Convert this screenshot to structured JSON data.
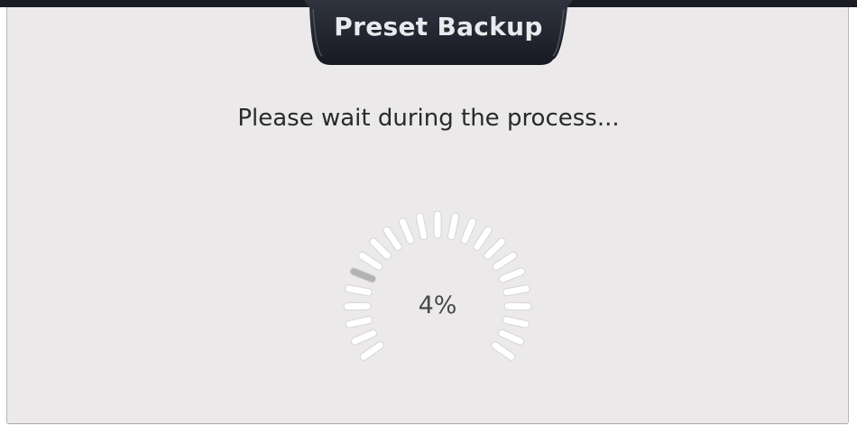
{
  "dialog": {
    "title": "Preset Backup",
    "message": "Please wait during the process..."
  },
  "progress": {
    "percent_label": "4%",
    "value_fraction": 0.04
  },
  "colors": {
    "title_tab": "#1c1f28",
    "title_text": "#e9eaee",
    "panel_background": "#ebe9ea",
    "segment_active": "#b3b3b3",
    "segment_inactive": "#ffffff"
  }
}
